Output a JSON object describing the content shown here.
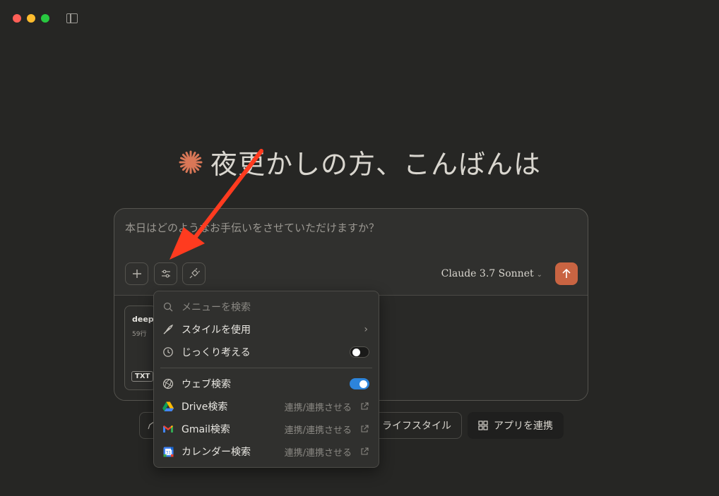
{
  "window": {
    "controls": [
      "close",
      "minimize",
      "maximize"
    ],
    "sidebar_icon": "sidebar-toggle-icon"
  },
  "greeting": {
    "text": "夜更かしの方、こんばんは",
    "icon": "claude-spark-icon",
    "accent_color": "#d97757"
  },
  "composer": {
    "placeholder": "本日はどのようなお手伝いをさせていただけますか？",
    "model": "Claude 3.7 Sonnet",
    "send_color": "#c96442",
    "attachment": {
      "name": "deep-",
      "lines": "59行",
      "type": "TXT"
    }
  },
  "suggestions": [
    {
      "label": "ライフスタイル",
      "icon": "coffee-icon"
    },
    {
      "label": "アプリを連携",
      "icon": "apps-grid-icon"
    }
  ],
  "menu": {
    "search_placeholder": "メニューを検索",
    "items": {
      "style": {
        "label": "スタイルを使用"
      },
      "extended_thinking": {
        "label": "じっくり考える",
        "enabled": false
      },
      "web_search": {
        "label": "ウェブ検索",
        "enabled": true
      },
      "drive": {
        "label": "Drive検索",
        "action": "連携/連携させる"
      },
      "gmail": {
        "label": "Gmail検索",
        "action": "連携/連携させる"
      },
      "calendar": {
        "label": "カレンダー検索",
        "action": "連携/連携させる"
      }
    },
    "toggle_on_color": "#2c84db"
  },
  "annotation": {
    "arrow_color": "#ff3b1f"
  }
}
